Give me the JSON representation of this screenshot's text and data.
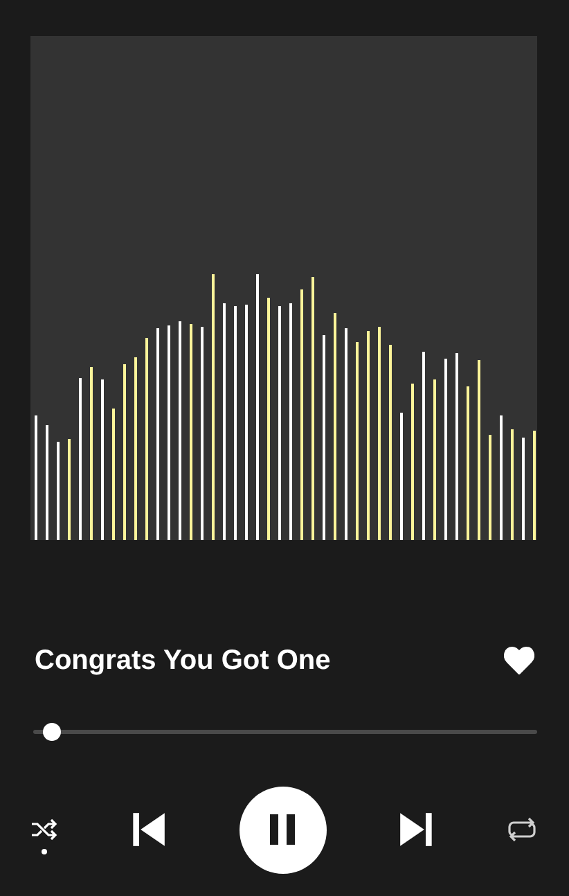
{
  "track": {
    "title": "Congrats You Got One",
    "liked": true
  },
  "progress": {
    "level": 0.02
  },
  "controls": {
    "shuffle": true,
    "playing": true,
    "repeat": false
  }
}
